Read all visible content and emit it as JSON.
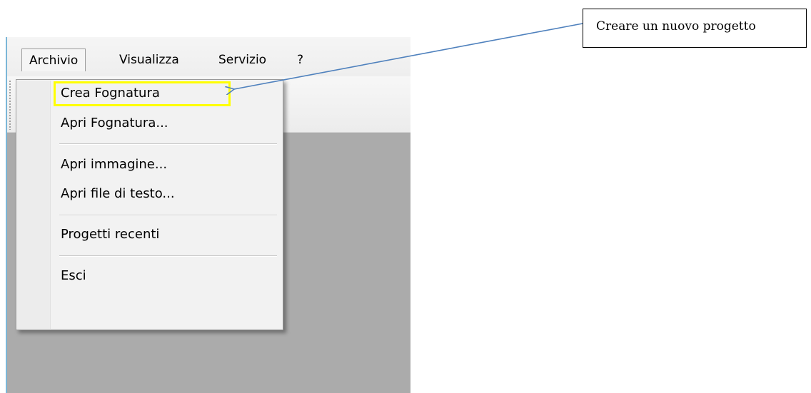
{
  "menubar": {
    "items": [
      {
        "label": "Archivio"
      },
      {
        "label": "Visualizza"
      },
      {
        "label": "Servizio"
      },
      {
        "label": "?"
      }
    ]
  },
  "dropdown": {
    "items": [
      {
        "label": "Crea Fognatura",
        "highlighted": true
      },
      {
        "label": "Apri Fognatura..."
      },
      {
        "label": "Apri immagine..."
      },
      {
        "label": "Apri file di testo..."
      },
      {
        "label": "Progetti recenti"
      },
      {
        "label": "Esci"
      }
    ]
  },
  "callout": {
    "text": "Creare un nuovo progetto"
  },
  "colors": {
    "highlight_border": "#ffff00",
    "arrow": "#4f81bd",
    "workspace": "#ababab"
  }
}
